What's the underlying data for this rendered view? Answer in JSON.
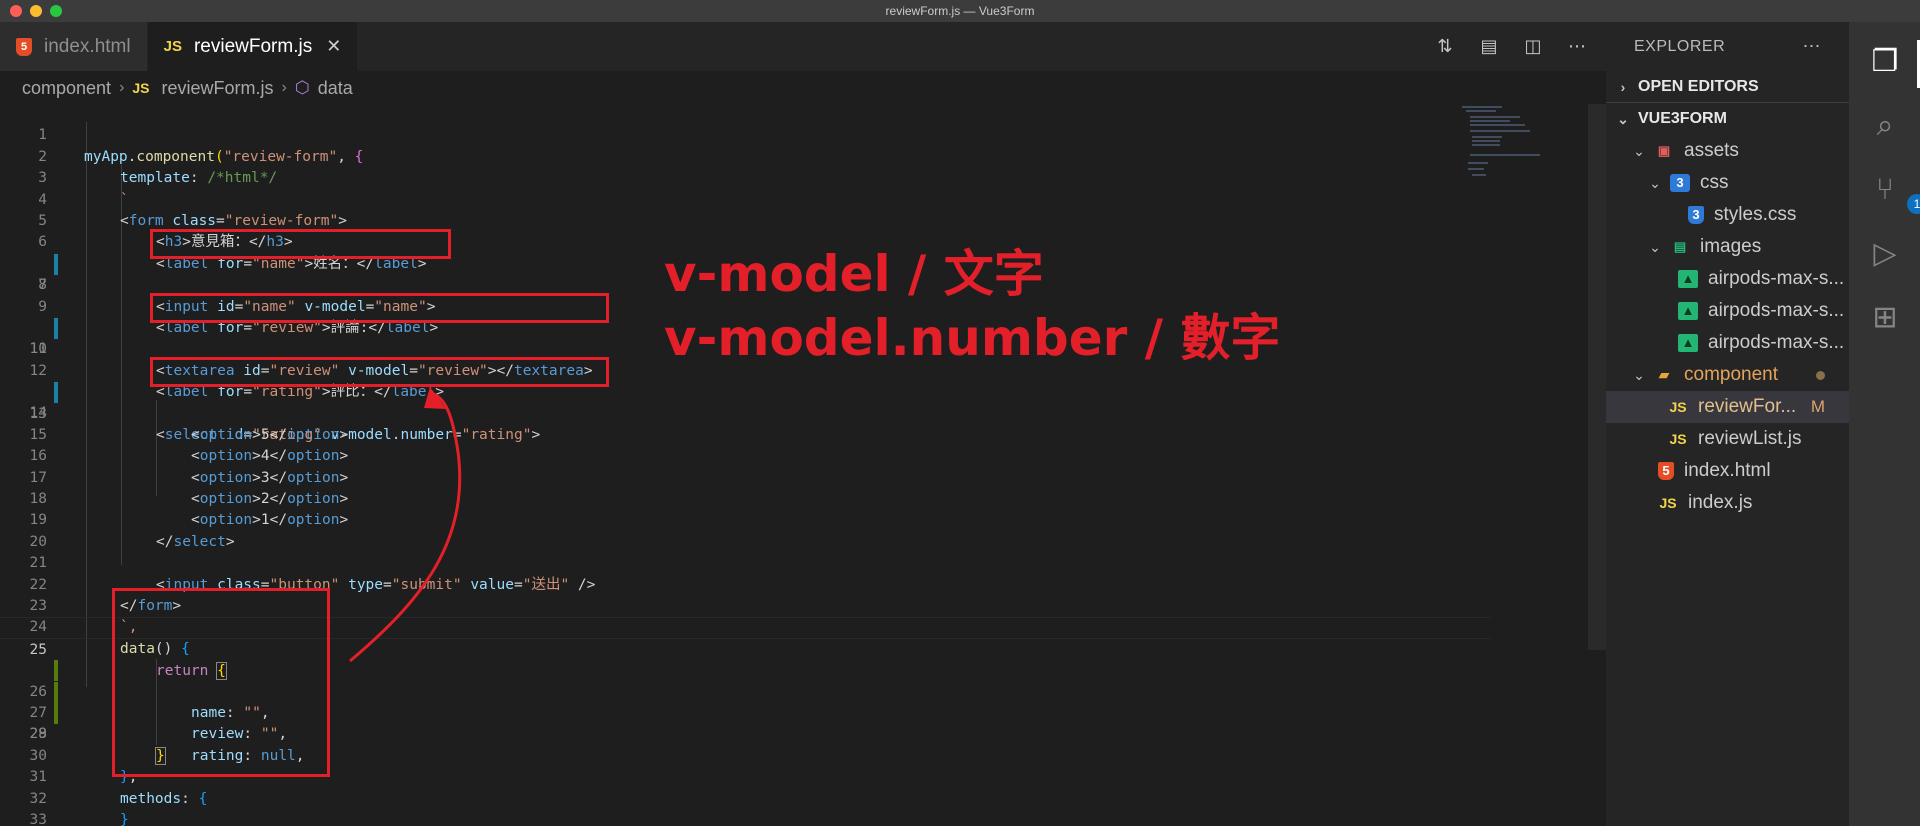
{
  "window": {
    "title": "reviewForm.js — Vue3Form"
  },
  "tabs": [
    {
      "label": "index.html",
      "icon": "html5-icon",
      "active": false
    },
    {
      "label": "reviewForm.js",
      "icon": "js-icon",
      "active": true
    }
  ],
  "tab_actions": [
    "compare-changes-icon",
    "open-preview-icon",
    "split-editor-icon",
    "more-actions-icon"
  ],
  "breadcrumb": {
    "folder": "component",
    "file": "reviewForm.js",
    "symbol": "data"
  },
  "code_lines": [
    {
      "n": "1"
    },
    {
      "n": "2"
    },
    {
      "n": "3"
    },
    {
      "n": "4"
    },
    {
      "n": "5"
    },
    {
      "n": "6"
    },
    {
      "n": "7"
    },
    {
      "n": "8"
    },
    {
      "n": "9"
    },
    {
      "n": "10"
    },
    {
      "n": "11"
    },
    {
      "n": "12"
    },
    {
      "n": "13"
    },
    {
      "n": "14"
    },
    {
      "n": "15"
    },
    {
      "n": "16"
    },
    {
      "n": "17"
    },
    {
      "n": "18"
    },
    {
      "n": "19"
    },
    {
      "n": "20"
    },
    {
      "n": "21"
    },
    {
      "n": "22"
    },
    {
      "n": "23"
    },
    {
      "n": "24"
    },
    {
      "n": "25"
    },
    {
      "n": "26"
    },
    {
      "n": "27"
    },
    {
      "n": "28"
    },
    {
      "n": "29"
    },
    {
      "n": "30"
    },
    {
      "n": "31"
    },
    {
      "n": "32"
    },
    {
      "n": "33"
    }
  ],
  "code": {
    "l1": [
      "myApp",
      ".",
      "component",
      "(",
      "\"review-form\"",
      ", ",
      "{"
    ],
    "l2": [
      "template",
      ": ",
      "/*html*/"
    ],
    "l3": [
      "`"
    ],
    "l4": [
      "<",
      "form",
      " class",
      "=",
      "\"review-form\"",
      ">"
    ],
    "l5": [
      "<",
      "h3",
      ">",
      "意見箱：",
      "</",
      "h3",
      ">"
    ],
    "l6": [
      "<",
      "label",
      " for",
      "=",
      "\"name\"",
      ">",
      "姓名：",
      "</",
      "label",
      ">"
    ],
    "l7": [
      "<",
      "input",
      " id",
      "=",
      "\"name\"",
      " v-model",
      "=",
      "\"name\"",
      ">"
    ],
    "l9": [
      "<",
      "label",
      " for",
      "=",
      "\"review\"",
      ">",
      "評論:",
      "</",
      "label",
      ">"
    ],
    "l10": [
      "<",
      "textarea",
      " id",
      "=",
      "\"review\"",
      " v-model",
      "=",
      "\"review\"",
      "></",
      "textarea",
      ">"
    ],
    "l12": [
      "<",
      "label",
      " for",
      "=",
      "\"rating\"",
      ">",
      "評比：",
      "</",
      "label",
      ">"
    ],
    "l13": [
      "<",
      "select",
      " id",
      "=",
      "\"rating\"",
      " v-model.number",
      "=",
      "\"rating\"",
      ">"
    ],
    "options": [
      "5",
      "4",
      "3",
      "2",
      "1"
    ],
    "option_tag": "option",
    "l19": [
      "</",
      "select",
      ">"
    ],
    "l21": [
      "<",
      "input",
      " class",
      "=",
      "\"button\"",
      " type",
      "=",
      "\"submit\"",
      " value",
      "=",
      "\"送出\"",
      " />"
    ],
    "l22": [
      "</",
      "form",
      ">"
    ],
    "l23": [
      "`,"
    ],
    "l24": [
      "data",
      "() ",
      "{"
    ],
    "l25": [
      "return",
      " ",
      "{"
    ],
    "l26": [
      "name",
      ": ",
      "\"\"",
      ","
    ],
    "l27": [
      "review",
      ": ",
      "\"\"",
      ","
    ],
    "l28": [
      "rating",
      ": ",
      "null",
      ","
    ],
    "l29": [
      "}"
    ],
    "l30": [
      "}",
      ","
    ],
    "l31": [
      "methods",
      ": ",
      "{"
    ],
    "l32": [
      "}"
    ],
    "l33": [
      "}",
      ")"
    ]
  },
  "annotations": {
    "line1": "v-model / 文字",
    "line2": "v-model.number / 數字",
    "color": "#e3202a"
  },
  "explorer": {
    "header": "EXPLORER",
    "open_editors": "OPEN EDITORS",
    "project": "VUE3FORM",
    "items": [
      {
        "label": "assets",
        "kind": "folder",
        "icon": "assets-folder-icon"
      },
      {
        "label": "css",
        "kind": "folder",
        "icon": "css-folder-icon"
      },
      {
        "label": "styles.css",
        "kind": "file",
        "icon": "css3-icon"
      },
      {
        "label": "images",
        "kind": "folder",
        "icon": "images-folder-icon"
      },
      {
        "label": "airpods-max-s...",
        "kind": "file",
        "icon": "image-file-icon"
      },
      {
        "label": "airpods-max-s...",
        "kind": "file",
        "icon": "image-file-icon"
      },
      {
        "label": "airpods-max-s...",
        "kind": "file",
        "icon": "image-file-icon"
      },
      {
        "label": "component",
        "kind": "folder",
        "icon": "component-folder-icon"
      },
      {
        "label": "reviewFor...",
        "kind": "file",
        "icon": "js-icon",
        "status": "M"
      },
      {
        "label": "reviewList.js",
        "kind": "file",
        "icon": "js-icon"
      },
      {
        "label": "index.html",
        "kind": "file",
        "icon": "html5-icon"
      },
      {
        "label": "index.js",
        "kind": "file",
        "icon": "js-icon"
      }
    ]
  },
  "activity_bar": {
    "scm_badge": "1"
  }
}
